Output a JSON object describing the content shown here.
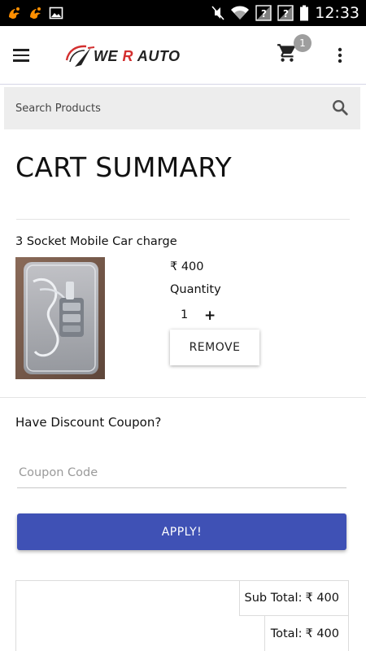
{
  "status_bar": {
    "time": "12:33",
    "left_icons": [
      "uc-browser-icon",
      "uc-browser-icon",
      "image-icon"
    ],
    "right_icons": [
      "mute-icon",
      "wifi-icon",
      "no-sim-icon",
      "no-sim-icon",
      "battery-icon"
    ]
  },
  "app_bar": {
    "logo_text_1": "WE ",
    "logo_text_r": "R",
    "logo_text_2": " AUTO",
    "cart_count": "1"
  },
  "search": {
    "placeholder": "Search Products"
  },
  "page": {
    "title": "CART SUMMARY"
  },
  "cart": {
    "items": [
      {
        "name": "3 Socket Mobile Car charge",
        "price": "₹ 400",
        "quantity_label": "Quantity",
        "quantity": "1",
        "plus_symbol": "+",
        "remove_label": "REMOVE"
      }
    ]
  },
  "coupon": {
    "label": "Have Discount Coupon?",
    "placeholder": "Coupon Code",
    "apply_label": "APPLY!"
  },
  "totals": {
    "subtotal_label": "Sub Total:",
    "subtotal_value": "₹ 400",
    "total_label": "Total:",
    "total_value": "₹ 400"
  },
  "colors": {
    "primary": "#3f51b5",
    "badge": "#9e9e9e",
    "search_bg": "#ededed",
    "logo_accent": "#d32f2f"
  }
}
